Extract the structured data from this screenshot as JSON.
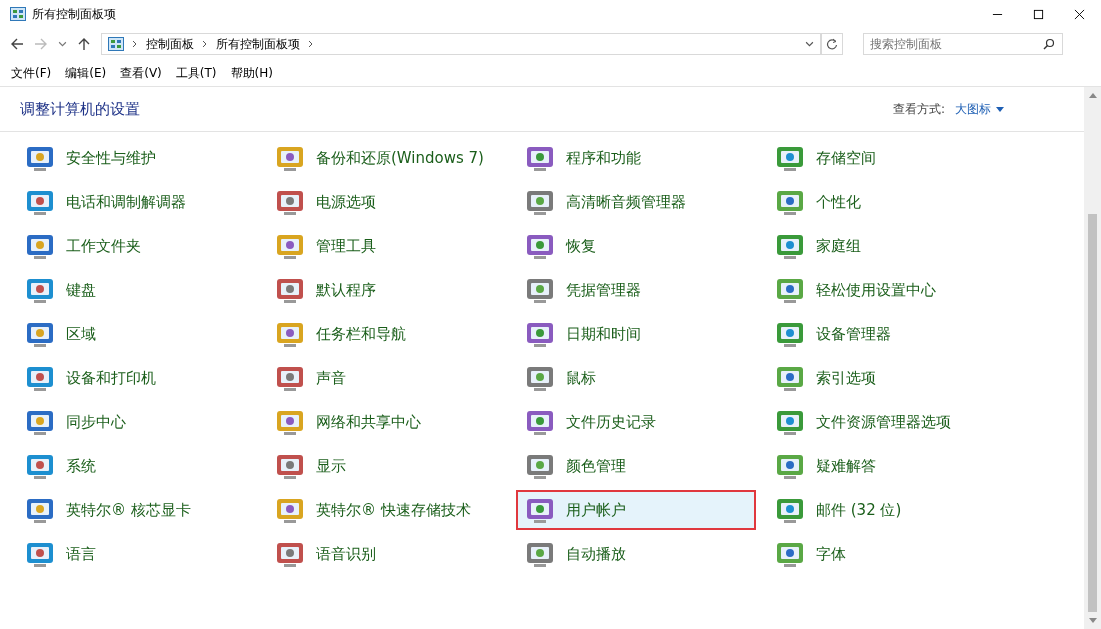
{
  "window": {
    "title": "所有控制面板项"
  },
  "address_bar": {
    "path": [
      "控制面板",
      "所有控制面板项"
    ]
  },
  "search": {
    "placeholder": "搜索控制面板"
  },
  "menu": [
    "文件(F)",
    "编辑(E)",
    "查看(V)",
    "工具(T)",
    "帮助(H)"
  ],
  "heading": "调整计算机的设置",
  "view_mode": {
    "label": "查看方式:",
    "value": "大图标"
  },
  "items": [
    {
      "label": "安全性与维护",
      "selected": false
    },
    {
      "label": "备份和还原(Windows 7)",
      "selected": false
    },
    {
      "label": "程序和功能",
      "selected": false
    },
    {
      "label": "存储空间",
      "selected": false
    },
    {
      "label": "电话和调制解调器",
      "selected": false
    },
    {
      "label": "电源选项",
      "selected": false
    },
    {
      "label": "高清晰音频管理器",
      "selected": false
    },
    {
      "label": "个性化",
      "selected": false
    },
    {
      "label": "工作文件夹",
      "selected": false
    },
    {
      "label": "管理工具",
      "selected": false
    },
    {
      "label": "恢复",
      "selected": false
    },
    {
      "label": "家庭组",
      "selected": false
    },
    {
      "label": "键盘",
      "selected": false
    },
    {
      "label": "默认程序",
      "selected": false
    },
    {
      "label": "凭据管理器",
      "selected": false
    },
    {
      "label": "轻松使用设置中心",
      "selected": false
    },
    {
      "label": "区域",
      "selected": false
    },
    {
      "label": "任务栏和导航",
      "selected": false
    },
    {
      "label": "日期和时间",
      "selected": false
    },
    {
      "label": "设备管理器",
      "selected": false
    },
    {
      "label": "设备和打印机",
      "selected": false
    },
    {
      "label": "声音",
      "selected": false
    },
    {
      "label": "鼠标",
      "selected": false
    },
    {
      "label": "索引选项",
      "selected": false
    },
    {
      "label": "同步中心",
      "selected": false
    },
    {
      "label": "网络和共享中心",
      "selected": false
    },
    {
      "label": "文件历史记录",
      "selected": false
    },
    {
      "label": "文件资源管理器选项",
      "selected": false
    },
    {
      "label": "系统",
      "selected": false
    },
    {
      "label": "显示",
      "selected": false
    },
    {
      "label": "颜色管理",
      "selected": false
    },
    {
      "label": "疑难解答",
      "selected": false
    },
    {
      "label": "英特尔® 核芯显卡",
      "selected": false
    },
    {
      "label": "英特尔® 快速存储技术",
      "selected": false
    },
    {
      "label": "用户帐户",
      "selected": true
    },
    {
      "label": "邮件 (32 位)",
      "selected": false
    },
    {
      "label": "语言",
      "selected": false
    },
    {
      "label": "语音识别",
      "selected": false
    },
    {
      "label": "自动播放",
      "selected": false
    },
    {
      "label": "字体",
      "selected": false
    }
  ]
}
